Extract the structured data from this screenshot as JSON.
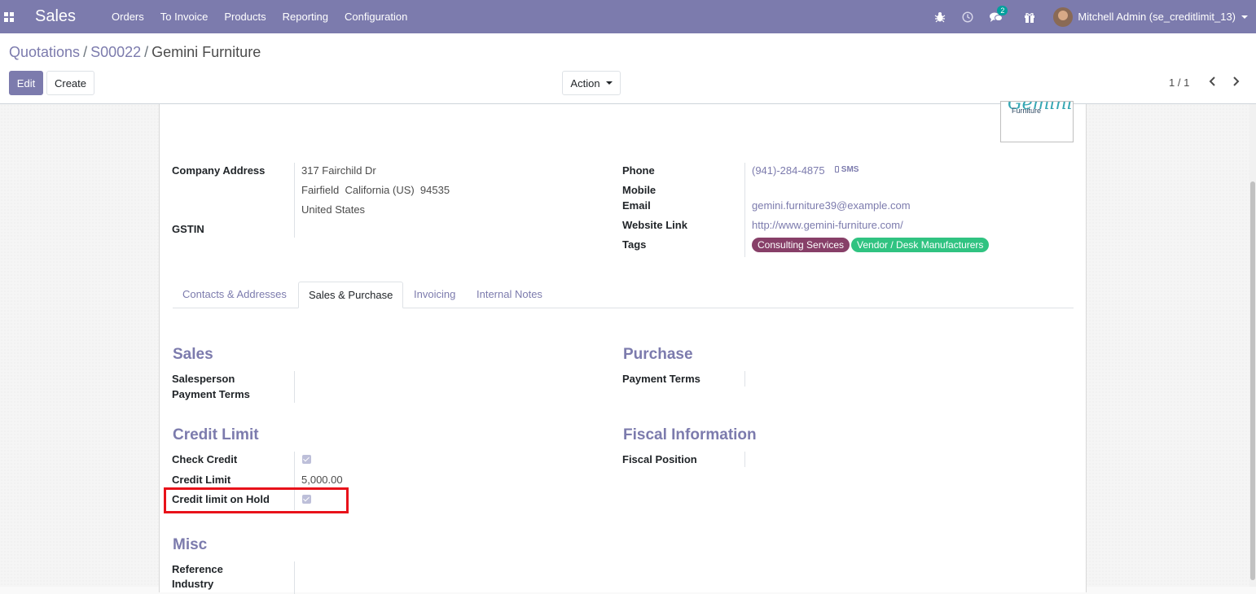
{
  "navbar": {
    "brand": "Sales",
    "menu": [
      "Orders",
      "To Invoice",
      "Products",
      "Reporting",
      "Configuration"
    ],
    "message_count": "2",
    "user_name": "Mitchell Admin (se_creditlimit_13)"
  },
  "breadcrumb": {
    "items": [
      "Quotations",
      "S00022"
    ],
    "current": "Gemini Furniture",
    "separator": "/"
  },
  "buttons": {
    "edit": "Edit",
    "create": "Create",
    "action": "Action"
  },
  "pager": {
    "value": "1 / 1"
  },
  "logo": {
    "script": "Gemini",
    "text": "Furniture"
  },
  "company": {
    "address_label": "Company Address",
    "street": "317 Fairchild Dr",
    "city_line": "Fairfield  California (US)  94535",
    "country": "United States",
    "gstin_label": "GSTIN"
  },
  "contact": {
    "phone_label": "Phone",
    "phone": "(941)-284-4875",
    "sms": "SMS",
    "mobile_label": "Mobile",
    "email_label": "Email",
    "email": "gemini.furniture39@example.com",
    "website_label": "Website Link",
    "website": "http://www.gemini-furniture.com/",
    "tags_label": "Tags",
    "tags": [
      {
        "label": "Consulting Services",
        "color": "#873f68"
      },
      {
        "label": "Vendor / Desk Manufacturers",
        "color": "#30c381"
      }
    ]
  },
  "tabs": [
    "Contacts & Addresses",
    "Sales & Purchase",
    "Invoicing",
    "Internal Notes"
  ],
  "active_tab": "Sales & Purchase",
  "sales": {
    "title": "Sales",
    "salesperson_label": "Salesperson",
    "payment_terms_label": "Payment Terms"
  },
  "purchase": {
    "title": "Purchase",
    "payment_terms_label": "Payment Terms"
  },
  "credit_limit": {
    "title": "Credit Limit",
    "check_credit_label": "Check Credit",
    "check_credit": true,
    "credit_limit_label": "Credit Limit",
    "credit_limit_value": "5,000.00",
    "on_hold_label": "Credit limit on Hold",
    "on_hold": true
  },
  "fiscal": {
    "title": "Fiscal Information",
    "fiscal_position_label": "Fiscal Position"
  },
  "misc": {
    "title": "Misc",
    "reference_label": "Reference",
    "industry_label": "Industry"
  },
  "colors": {
    "brand": "#7c7bad",
    "highlight": "#e8121a"
  }
}
